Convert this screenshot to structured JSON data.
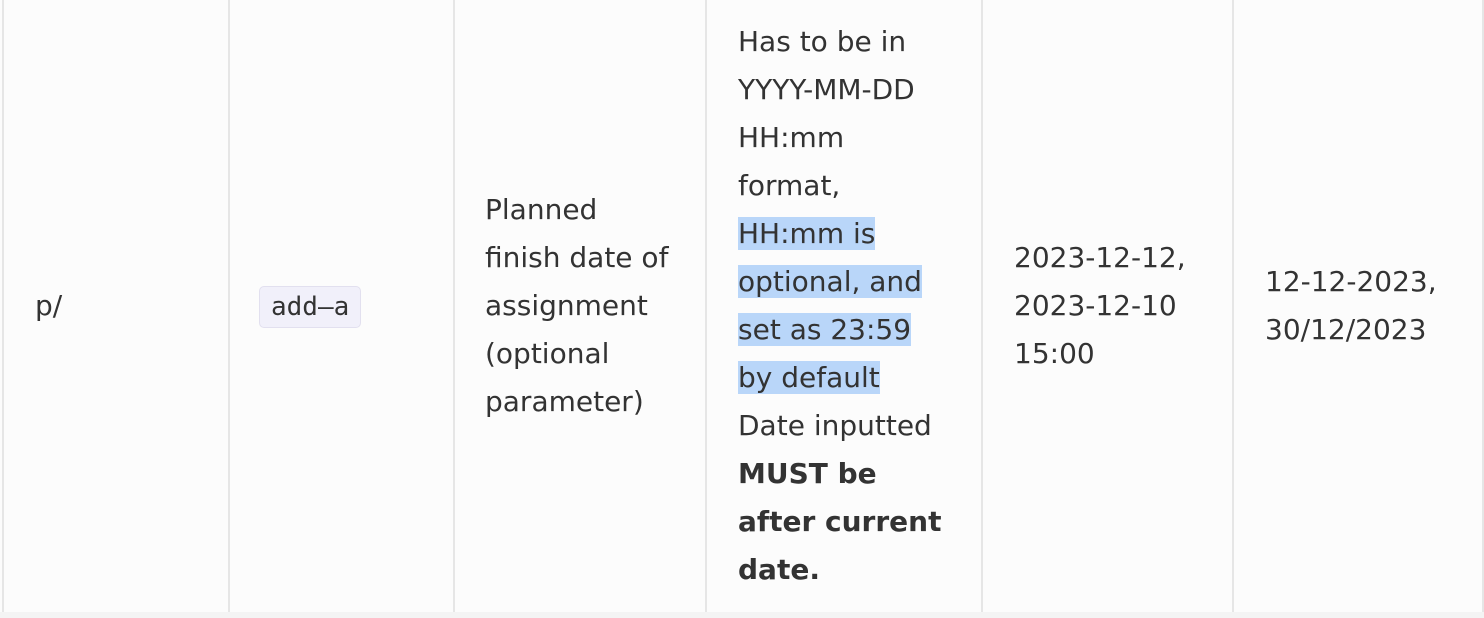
{
  "table": {
    "row": {
      "prefix": "p/",
      "command": "add–a",
      "description_lines": [
        "Planned",
        "finish date of",
        "assignment",
        "(optional",
        "parameter)"
      ],
      "format_lines": [
        "Has to be in",
        "YYYY-MM-DD",
        "HH:mm",
        "format,"
      ],
      "format_highlight_lines": [
        "HH:mm is",
        "optional, and",
        "set as 23:59",
        "by default"
      ],
      "format_after_line": "Date inputted",
      "format_bold_lines": [
        "MUST be",
        "after current",
        "date."
      ],
      "valid_example_lines": [
        "2023-12-12,",
        "2023-12-10",
        "15:00"
      ],
      "invalid_example_lines": [
        "12-12-2023,",
        "30/12/2023"
      ]
    }
  },
  "colors": {
    "highlight": "#b9d6f9",
    "text": "#333333",
    "border": "#e6e6e6",
    "code_background": "#f1f0fa"
  }
}
